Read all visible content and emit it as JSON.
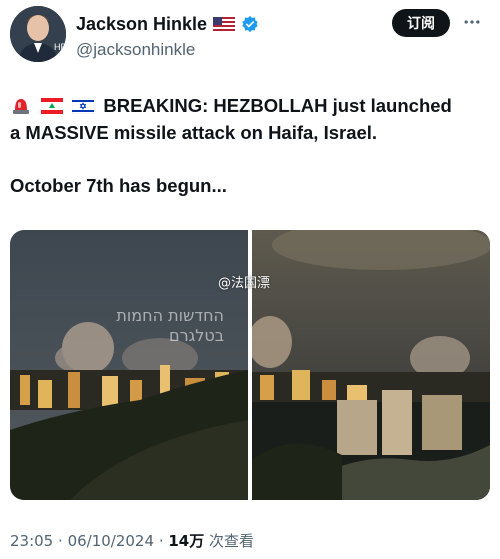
{
  "author": {
    "name": "Jackson Hinkle",
    "handle": "@jacksonhinkle",
    "flag_icon": "us-flag-icon",
    "verified_icon": "verified-badge-icon",
    "avatar_overlay_text": "HB"
  },
  "follow_button_label": "订阅",
  "more_icon": "more-options-icon",
  "tweet": {
    "emojis": [
      "siren-icon",
      "lebanon-flag-icon",
      "israel-flag-icon"
    ],
    "line1": "BREAKING: HEZBOLLAH just launched",
    "line2": "a MASSIVE missile attack on Haifa, Israel.",
    "line3": "October 7th has begun..."
  },
  "media": {
    "watermark": "@法国漂",
    "left_overlay_line1": "החדשות החמות",
    "left_overlay_line2": "בטלגרם"
  },
  "meta": {
    "time": "23:05",
    "date": "06/10/2024",
    "views_count": "14万",
    "views_label": "次查看"
  },
  "colors": {
    "text": "#0f1419",
    "secondary": "#536471",
    "verified": "#1d9bf0",
    "button_bg": "#0f1419"
  }
}
